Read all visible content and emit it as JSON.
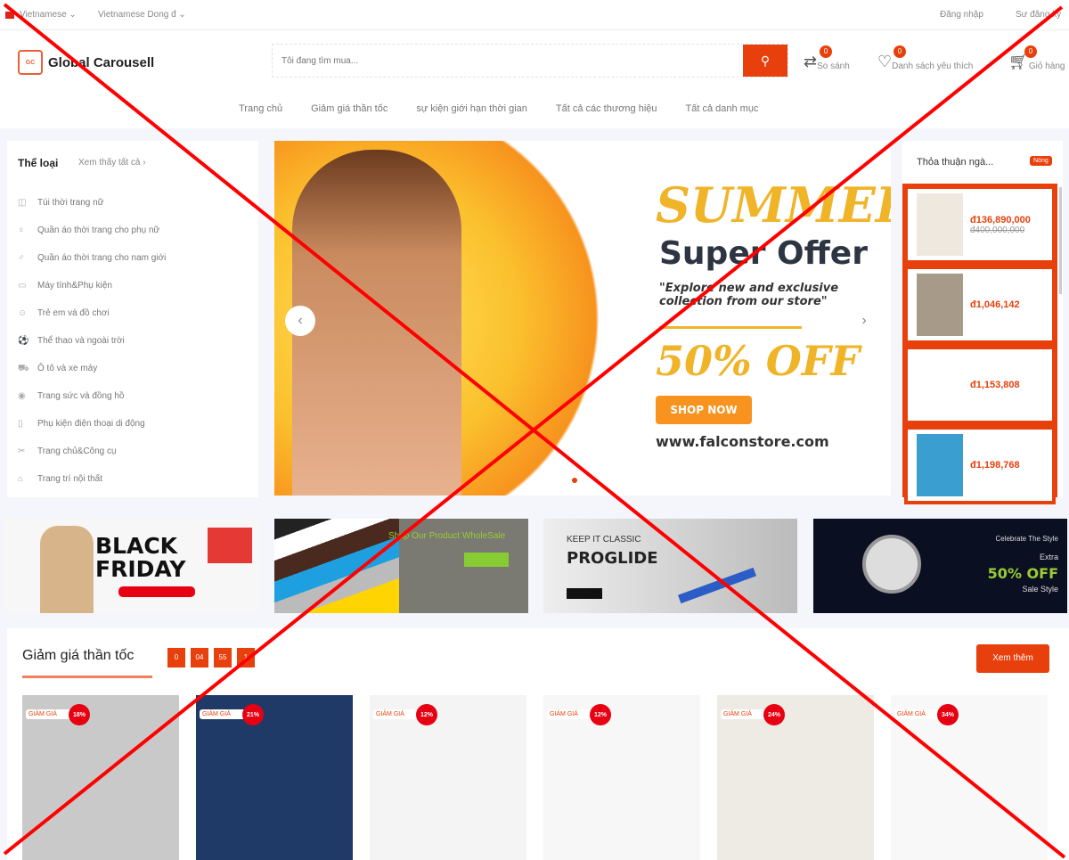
{
  "topbar": {
    "language": "Vietnamese ⌄",
    "currency": "Vietnamese Dong đ ⌄",
    "login": "Đăng nhập",
    "register": "Sư đăng ký"
  },
  "header": {
    "logo": "Global Carousell",
    "logo_mark": "GC",
    "search_placeholder": "Tôi đang tìm mua...",
    "compare": "So sánh",
    "compare_count": "0",
    "wishlist": "Danh sách yêu thích",
    "wishlist_count": "0",
    "cart": "Giỏ hàng",
    "cart_count": "0"
  },
  "nav": [
    "Trang chủ",
    "Giảm giá thần tốc",
    "sự kiện giới hạn thời gian",
    "Tất cả các thương hiệu",
    "Tất cả danh mục"
  ],
  "sidebar": {
    "title": "Thể loại",
    "view_all": "Xem thấy tất cả ›",
    "items": [
      "Túi thời trang nữ",
      "Quần áo thời trang cho phụ nữ",
      "Quần áo thời trang cho nam giới",
      "Máy tính&Phụ kiện",
      "Trẻ em và đồ chơi",
      "Thể thao và ngoài trời",
      "Ô tô và xe máy",
      "Trang sức và đồng hồ",
      "Phụ kiện điện thoại di động",
      "Trang chủ&Công cụ",
      "Trang trí nội thất"
    ]
  },
  "hero": {
    "title": "SUMMER",
    "subtitle": "Super Offer",
    "tagline": "\"Explore new and exclusive collection from our store\"",
    "offer": "50% OFF",
    "cta": "SHOP NOW",
    "url": "www.falconstore.com"
  },
  "deals": {
    "title": "Thỏa thuận ngà...",
    "badge": "Nóng",
    "items": [
      {
        "price": "đ136,890,000",
        "old": "đ400,000,000"
      },
      {
        "price": "đ1,046,142"
      },
      {
        "price": "đ1,153,808"
      },
      {
        "price": "đ1,198,768"
      }
    ]
  },
  "promos": [
    {
      "title": "BLACK FRIDAY"
    },
    {
      "title": "Shop Our Product WholeSale"
    },
    {
      "kicker": "KEEP IT CLASSIC",
      "title": "PROGLIDE"
    },
    {
      "kicker": "Celebrate The Style",
      "line": "Extra",
      "title": "50% OFF",
      "sub": "Sale Style"
    }
  ],
  "flash": {
    "title": "Giảm giá thần tốc",
    "countdown": [
      "0",
      "04",
      "55",
      "1"
    ],
    "more": "Xem thêm",
    "tag": "GIẢM GIÁ",
    "items": [
      {
        "discount": "18%"
      },
      {
        "discount": "21%"
      },
      {
        "discount": "12%"
      },
      {
        "discount": "12%"
      },
      {
        "discount": "24%"
      },
      {
        "discount": "34%"
      }
    ]
  },
  "colors": {
    "accent": "#e8400c",
    "cross": "#ff0000"
  }
}
